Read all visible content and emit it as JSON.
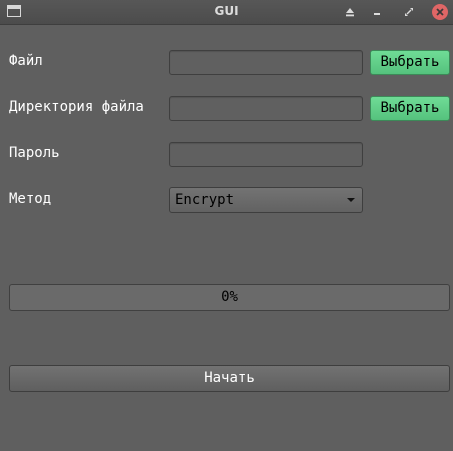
{
  "window": {
    "title": "GUI",
    "icons": [
      "app-window-icon",
      "shade-icon",
      "minimize-icon",
      "maximize-icon",
      "close-icon"
    ],
    "close_color": "#e06666"
  },
  "form": {
    "file_label": "Файл",
    "file_value": "",
    "file_browse_label": "Выбрать",
    "dir_label": "Директория файла",
    "dir_value": "",
    "dir_browse_label": "Выбрать",
    "password_label": "Пароль",
    "password_value": "",
    "method_label": "Метод",
    "method_selected": "Encrypt"
  },
  "progress": {
    "text": "0%",
    "value": 0
  },
  "actions": {
    "start_label": "Начать"
  },
  "colors": {
    "background": "#5f5f5f",
    "accent_green": "#5fcf88"
  }
}
